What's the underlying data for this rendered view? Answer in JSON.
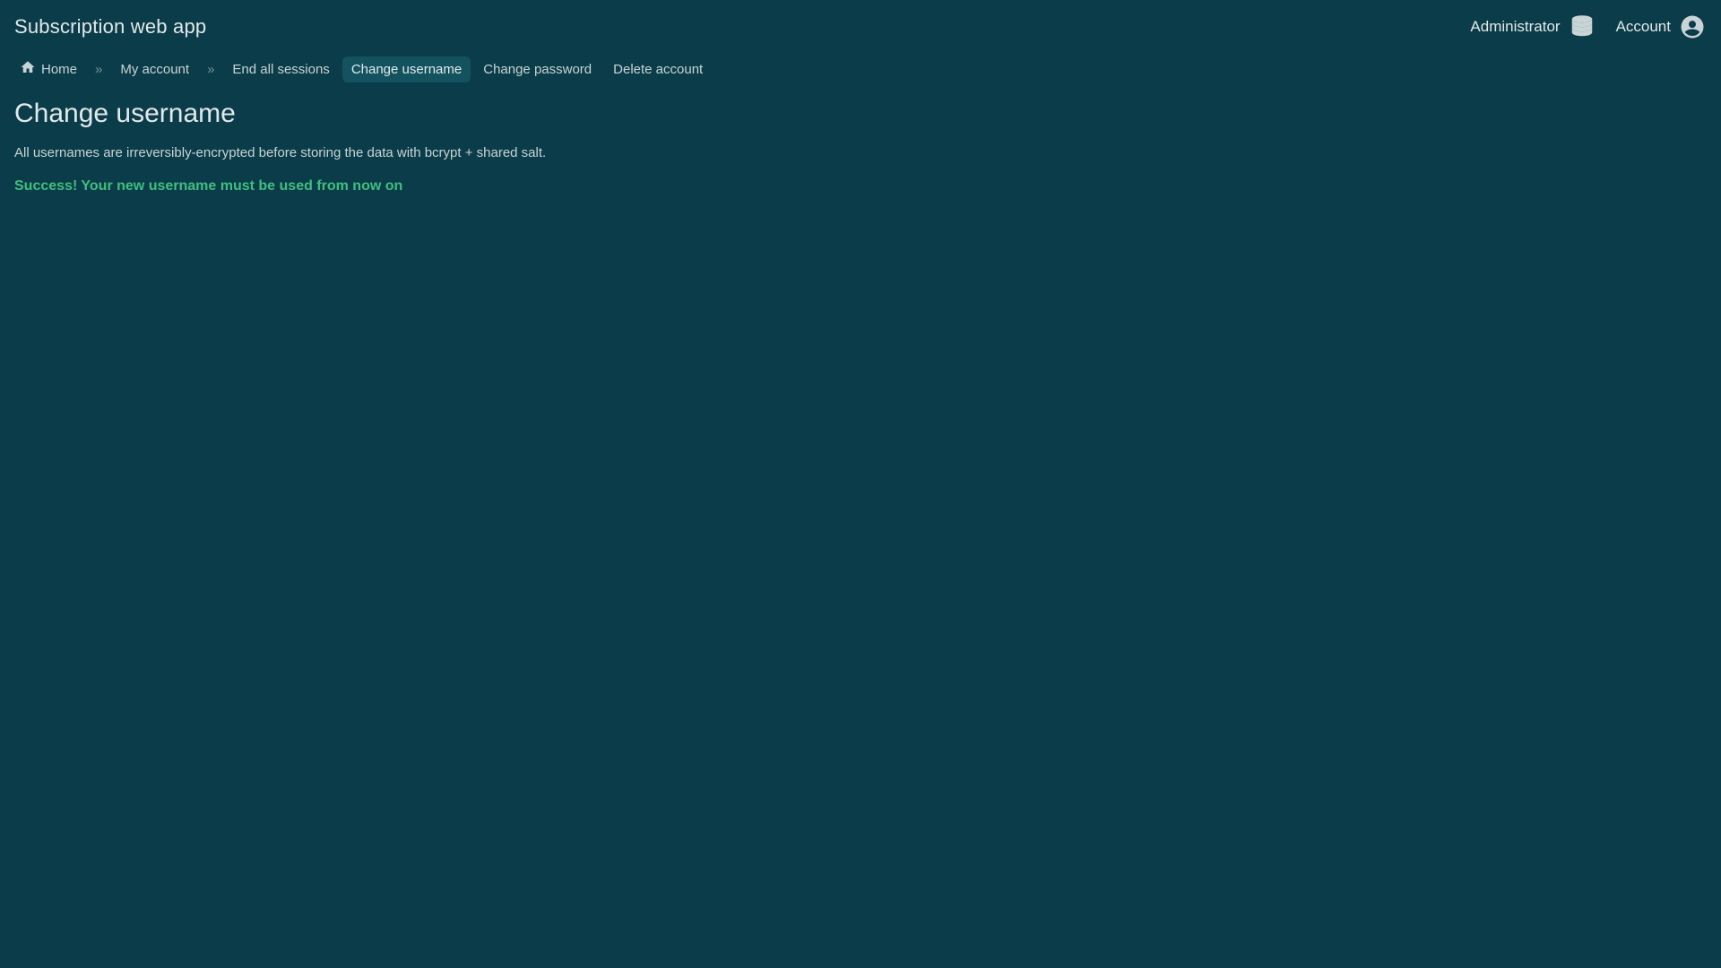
{
  "header": {
    "app_title": "Subscription web app",
    "admin_label": "Administrator",
    "account_label": "Account"
  },
  "breadcrumb": {
    "home": "Home",
    "sep": "»",
    "my_account": "My account"
  },
  "tabs": {
    "end_sessions": "End all sessions",
    "change_username": "Change username",
    "change_password": "Change password",
    "delete_account": "Delete account",
    "active": "change_username"
  },
  "page": {
    "title": "Change username",
    "info": "All usernames are irreversibly-encrypted before storing the data with bcrypt + shared salt.",
    "success": "Success! Your new username must be used from now on"
  },
  "colors": {
    "background": "#0b3c49",
    "active_pill": "#135360",
    "success_text": "#3fbf7f"
  }
}
